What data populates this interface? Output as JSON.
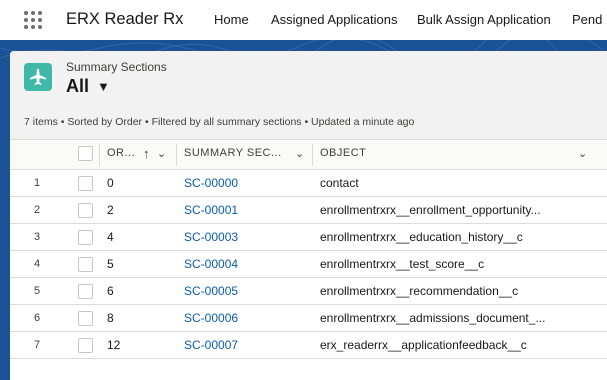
{
  "topbar": {
    "app_name": "ERX Reader Rx",
    "nav_items": [
      "Home",
      "Assigned Applications",
      "Bulk Assign Application",
      "Pend"
    ]
  },
  "header": {
    "object_label": "Summary Sections",
    "list_view": "All",
    "status": "7 items • Sorted by Order • Filtered by all summary sections • Updated a minute ago"
  },
  "table": {
    "columns": [
      "OR...",
      "SUMMARY SEC...",
      "OBJECT"
    ],
    "rows": [
      {
        "num": "1",
        "order": "0",
        "section": "SC-00000",
        "object": "contact"
      },
      {
        "num": "2",
        "order": "2",
        "section": "SC-00001",
        "object": "enrollmentrxrx__enrollment_opportunity..."
      },
      {
        "num": "3",
        "order": "4",
        "section": "SC-00003",
        "object": "enrollmentrxrx__education_history__c"
      },
      {
        "num": "4",
        "order": "5",
        "section": "SC-00004",
        "object": "enrollmentrxrx__test_score__c"
      },
      {
        "num": "5",
        "order": "6",
        "section": "SC-00005",
        "object": "enrollmentrxrx__recommendation__c"
      },
      {
        "num": "6",
        "order": "8",
        "section": "SC-00006",
        "object": "enrollmentrxrx__admissions_document_..."
      },
      {
        "num": "7",
        "order": "12",
        "section": "SC-00007",
        "object": "erx_readerrx__applicationfeedback__c"
      }
    ]
  },
  "colors": {
    "brand_band": "#1b5297",
    "link": "#0b5cab",
    "object_icon": "#3fb8a8"
  },
  "icons": [
    "app-launcher-icon",
    "object-icon",
    "sort-up-icon",
    "chevron-down-icon"
  ]
}
